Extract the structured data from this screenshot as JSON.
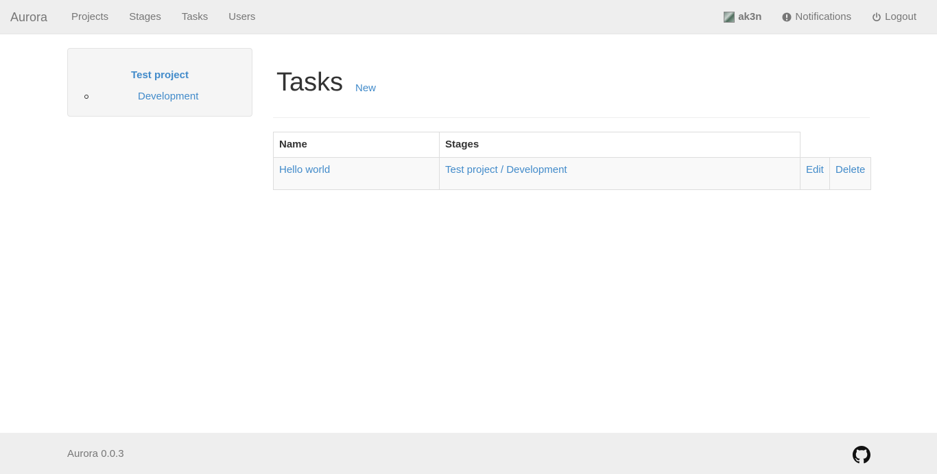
{
  "navbar": {
    "brand": "Aurora",
    "links": [
      "Projects",
      "Stages",
      "Tasks",
      "Users"
    ],
    "user": "ak3n",
    "notifications": "Notifications",
    "logout": "Logout"
  },
  "sidebar": {
    "project": "Test project",
    "stages": [
      "Development"
    ]
  },
  "main": {
    "title": "Tasks",
    "new_link": "New",
    "table": {
      "headers": [
        "Name",
        "Stages"
      ],
      "rows": [
        {
          "name": "Hello world",
          "stages": "Test project / Development",
          "edit": "Edit",
          "delete": "Delete"
        }
      ]
    }
  },
  "footer": {
    "version": "Aurora 0.0.3"
  },
  "icons": {
    "notification": "exclamation-circle-icon",
    "logout": "power-icon",
    "footer": "github-icon"
  },
  "colors": {
    "link": "#428bca",
    "navbar_bg": "#eeeeee",
    "text": "#333333",
    "muted": "#777777"
  }
}
